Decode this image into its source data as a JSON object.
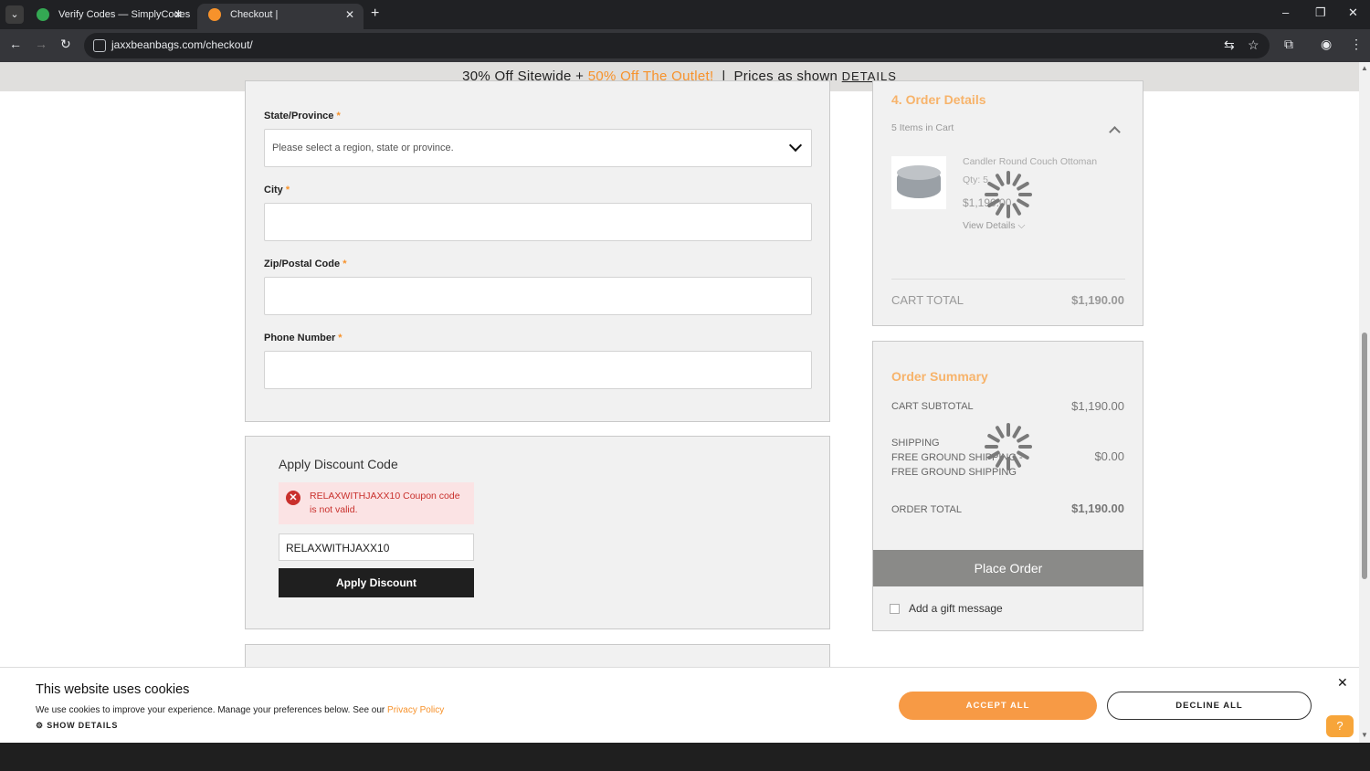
{
  "browser": {
    "tabs": [
      {
        "title": "Verify Codes — SimplyCodes",
        "favicon_color": "#34a853"
      },
      {
        "title": "Checkout | Jaxxbeanbags.com",
        "favicon_color": "#f7922b"
      }
    ],
    "url": "jaxxbeanbags.com/checkout/",
    "new_tab": "+",
    "close_glyph": "✕"
  },
  "promo": {
    "text_1": "30% Off Sitewide + ",
    "link": "50% Off The Outlet!",
    "text_2": "  |  Prices as shown ",
    "details": "DETAILS"
  },
  "address_form": {
    "state_label": "State/Province",
    "state_placeholder": "Please select a region, state or province.",
    "city_label": "City",
    "zip_label": "Zip/Postal Code",
    "phone_label": "Phone Number",
    "required_mark": "*"
  },
  "discount": {
    "title": "Apply Discount Code",
    "error": "RELAXWITHJAXX10 Coupon code is not valid.",
    "error_icon": "✕",
    "code_value": "RELAXWITHJAXX10",
    "button": "Apply Discount"
  },
  "order_details": {
    "title": "4. Order Details",
    "items_count": "5 Items in Cart",
    "product_name": "Candler Round Couch Ottoman",
    "product_qty": "Qty:  5",
    "product_price": "$1,190.00",
    "view_details": "View Details",
    "cart_total_label": "CART TOTAL",
    "cart_total_value": "$1,190.00"
  },
  "order_summary": {
    "title": "Order Summary",
    "subtotal_label": "CART SUBTOTAL",
    "subtotal_value": "$1,190.00",
    "shipping_label": "SHIPPING",
    "shipping_method": "FREE GROUND SHIPPING - FREE GROUND SHIPPING",
    "shipping_value": "$0.00",
    "order_total_label": "ORDER TOTAL",
    "order_total_value": "$1,190.00",
    "place_order": "Place Order",
    "gift_message": "Add a gift message"
  },
  "cookie_banner": {
    "title": "This website uses cookies",
    "text": "We use cookies to improve your experience. Manage your preferences below. See our ",
    "policy_link": "Privacy Policy",
    "show_details": "SHOW DETAILS",
    "accept": "ACCEPT ALL",
    "decline": "DECLINE ALL",
    "close": "✕",
    "help": "?"
  },
  "colors": {
    "accent_orange": "#f7922b",
    "error_red": "#c9302c",
    "button_dark": "#1f1f1f"
  },
  "icons": [
    "tab-list-icon",
    "back-icon",
    "forward-icon",
    "reload-icon",
    "site-info-icon",
    "translate-icon",
    "star-icon",
    "extensions-icon",
    "profile-icon",
    "menu-icon",
    "chevron-down-icon",
    "chevron-up-icon",
    "error-icon",
    "loading-spinner-icon",
    "gear-icon",
    "close-icon",
    "help-icon"
  ]
}
